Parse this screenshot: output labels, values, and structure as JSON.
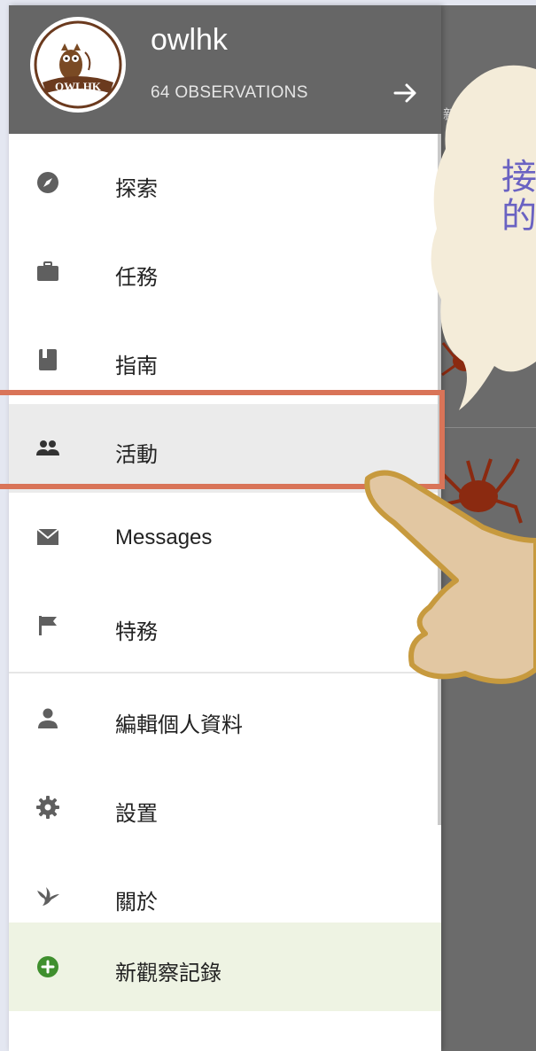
{
  "account": {
    "username": "owlhk",
    "observations": "64 OBSERVATIONS",
    "logo_text": "OWLHK"
  },
  "background": {
    "partial_text": "新聞"
  },
  "tutorial": {
    "bubble_text_line1": "接",
    "bubble_text_line2": "的"
  },
  "menu": {
    "items": [
      {
        "label": "探索",
        "icon": "compass-icon"
      },
      {
        "label": "任務",
        "icon": "briefcase-icon"
      },
      {
        "label": "指南",
        "icon": "book-icon"
      },
      {
        "label": "活動",
        "icon": "people-icon",
        "selected": true
      },
      {
        "label": "Messages",
        "icon": "envelope-icon"
      },
      {
        "label": "特務",
        "icon": "flag-icon"
      },
      {
        "label": "編輯個人資料",
        "icon": "person-icon"
      },
      {
        "label": "設置",
        "icon": "gear-icon"
      },
      {
        "label": "關於",
        "icon": "bird-icon"
      },
      {
        "label": "新觀察記錄",
        "icon": "plus-circle-icon"
      }
    ]
  },
  "colors": {
    "header": "#666666",
    "highlight_border": "#d97458",
    "add_accent": "#3f8f2e",
    "bubble_text": "#6a62c2"
  }
}
